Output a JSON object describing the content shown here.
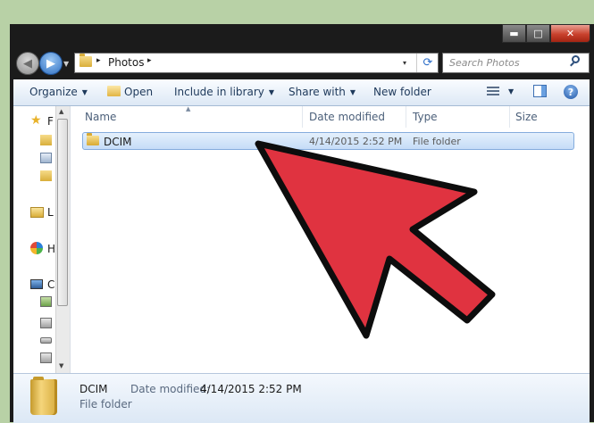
{
  "window": {
    "caption_buttons": {
      "minimize": "▬",
      "maximize": "□",
      "close": "✕"
    }
  },
  "address_bar": {
    "breadcrumb": [
      "Photos"
    ],
    "separator_glyph": "▸",
    "dropdown_glyph": "▾",
    "refresh_glyph": "⟳"
  },
  "search": {
    "placeholder": "Search Photos"
  },
  "toolbar": {
    "organize": "Organize",
    "open": "Open",
    "include_in_library": "Include in library",
    "share_with": "Share with",
    "new_folder": "New folder",
    "help_glyph": "?"
  },
  "nav_pane": {
    "items": [
      {
        "icon": "star-icon",
        "label": "F"
      },
      {
        "icon": "folder-icon",
        "label": ""
      },
      {
        "icon": "document-icon",
        "label": ""
      },
      {
        "icon": "folder-icon",
        "label": ""
      },
      {
        "icon": "library-icon",
        "label": "L"
      },
      {
        "icon": "homegroup-icon",
        "label": "H"
      },
      {
        "icon": "computer-icon",
        "label": "C"
      },
      {
        "icon": "drive-icon",
        "label": ""
      },
      {
        "icon": "drive-icon",
        "label": ""
      },
      {
        "icon": "drive-icon",
        "label": ""
      },
      {
        "icon": "drive-icon",
        "label": ""
      }
    ]
  },
  "file_list": {
    "columns": [
      "Name",
      "Date modified",
      "Type",
      "Size"
    ],
    "rows": [
      {
        "name": "DCIM",
        "date_modified": "4/14/2015 2:52 PM",
        "type": "File folder",
        "size": ""
      }
    ]
  },
  "details_pane": {
    "name": "DCIM",
    "date_label": "Date modified:",
    "date_value": "4/14/2015 2:52 PM",
    "type": "File folder"
  },
  "colors": {
    "background": "#b8d1a6",
    "window_frame": "#1b1b1b",
    "pointer_arrow": "#e03340",
    "selection": "#c5dcf7",
    "toolbar_text": "#1e395b"
  }
}
